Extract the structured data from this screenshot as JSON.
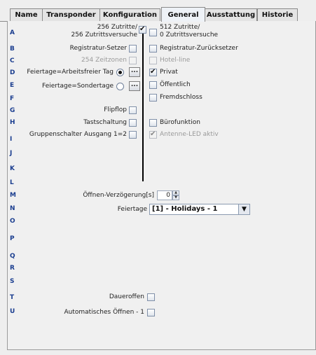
{
  "tabs": [
    "Name",
    "Transponder",
    "Konfiguration",
    "General",
    "Ausstattung",
    "Historie"
  ],
  "alphabet": [
    "A",
    "B",
    "C",
    "D",
    "E",
    "F",
    "G",
    "H",
    "I",
    "J",
    "K",
    "L",
    "M",
    "N",
    "O",
    "P",
    "Q",
    "R",
    "S",
    "T",
    "U"
  ],
  "left": {
    "access256_line1": "256 Zutritte/",
    "access256_line2": "256 Zutrittsversuche",
    "registrar_setter": "Registratur-Setzer",
    "timezones254": "254 Zeitzonen",
    "holiday_free": "Feiertage=Arbeitsfreier Tag",
    "holiday_special": "Feiertage=Sondertage",
    "flipflop": "Flipflop",
    "pushbutton": "Tastschaltung",
    "group_switch": "Gruppenschalter Ausgang 1=2",
    "dots": "..."
  },
  "right": {
    "access512_line1": "512 Zutritte/",
    "access512_line2": "0 Zutrittsversuche",
    "registrar_reset": "Registratur-Zurücksetzer",
    "hotel_line": "Hotel-line",
    "private": "Privat",
    "public": "Öffentlich",
    "foreign_lock": "Fremdschloss",
    "office_function": "Bürofunktion",
    "antenna_led": "Antenne-LED aktiv"
  },
  "bottom": {
    "open_delay_label": "Öffnen-Verzögerung[s]",
    "open_delay_value": "0",
    "holidays_label": "Feiertage",
    "holidays_value": "[1] - Holidays - 1",
    "permanent_open": "Daueroffen",
    "auto_open": "Automatisches Öffnen - 1"
  }
}
